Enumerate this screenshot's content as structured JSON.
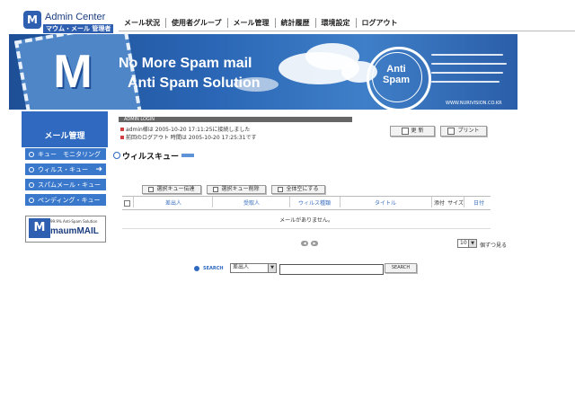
{
  "header": {
    "logo_mark": "M",
    "app_title": "Admin Center",
    "app_subtitle": "マウム・メール 管理者"
  },
  "topnav": [
    "メール状況",
    "使用者グループ",
    "メール管理",
    "統計履歴",
    "環境設定",
    "ログアウト"
  ],
  "banner": {
    "logo_mark": "M",
    "headline1": "No More Spam mail",
    "headline2": "Anti Spam Solution",
    "seal_text": "Anti\nSpam",
    "url": "WWW.NURIVISION.CO.KR"
  },
  "sidebar": {
    "title": "メール管理",
    "items": [
      {
        "label": "キュー　モニタリング",
        "active": false
      },
      {
        "label": "ウィルス・キュー",
        "active": true
      },
      {
        "label": "スパムメール・キュー",
        "active": false
      },
      {
        "label": "ペンディング・キュー",
        "active": false
      }
    ],
    "promo": {
      "tagline": "99.9% Anti-Spam Solution",
      "brand": "maumMAIL",
      "mark": "M"
    }
  },
  "login": {
    "header": "ADMIN LOGIN",
    "line1": "admin様は 2005-10-20 17:11:25に接続しました",
    "line2": "前回のログアウト 時間は 2005-10-20 17:25:31です"
  },
  "top_buttons": {
    "refresh": "更 新",
    "print": "プリント"
  },
  "page_title": "ウィルスキュー",
  "actions": {
    "send": "選択キュー伝達",
    "delete": "選択キュー削除",
    "select_all": "全体空にする"
  },
  "table": {
    "columns": [
      "差出人",
      "受取人",
      "ウィルス種類",
      "タイトル",
      "添付",
      "サイズ",
      "日付"
    ],
    "empty_message": "メールがありません。"
  },
  "pagination": {
    "per_page_value": "10",
    "per_page_suffix": "個ずつ見る",
    "prev": "◀",
    "next": "▶"
  },
  "search": {
    "label": "SEARCH",
    "field_value": "差出人",
    "query": "",
    "button": "SEARCH"
  },
  "colors": {
    "brand_blue": "#2f6ac0",
    "banner_blue": "#1e4f96",
    "header_text": "#3a6fc0"
  }
}
